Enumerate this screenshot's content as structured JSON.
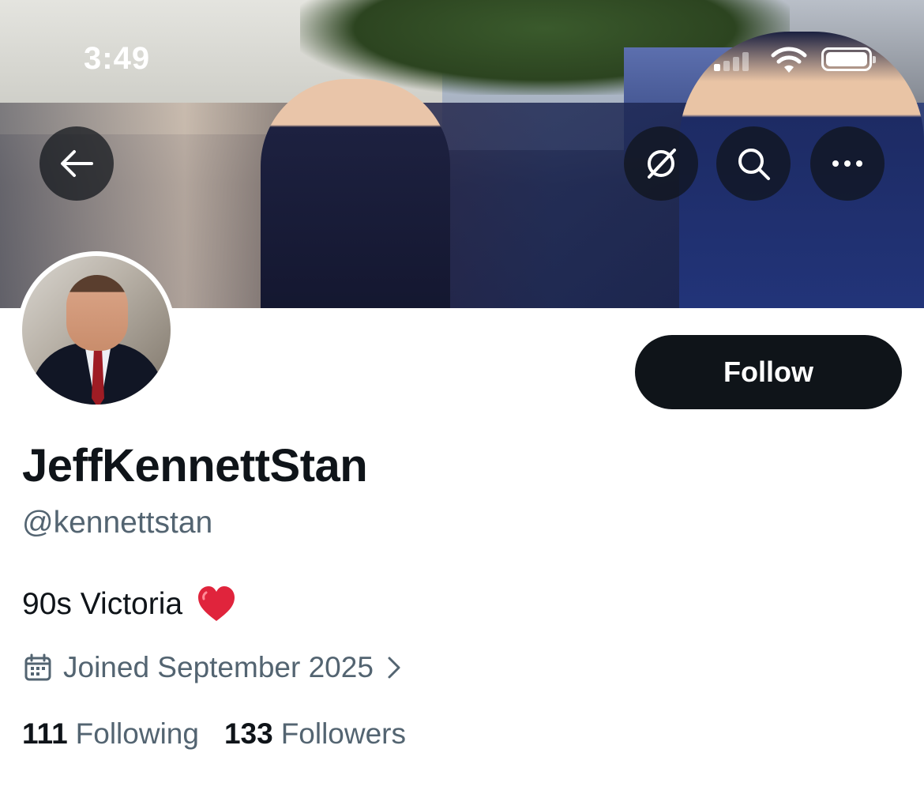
{
  "status_bar": {
    "time": "3:49"
  },
  "header": {
    "back_icon": "back-arrow-icon",
    "grok_icon": "grok-icon",
    "search_icon": "search-icon",
    "more_icon": "more-icon"
  },
  "profile": {
    "display_name": "JeffKennettStan",
    "handle": "@kennettstan",
    "bio_text": "90s Victoria",
    "bio_emoji": "heart-icon",
    "joined": "Joined September 2025",
    "following_count": "111",
    "following_label": "Following",
    "followers_count": "133",
    "followers_label": "Followers"
  },
  "actions": {
    "follow_label": "Follow"
  },
  "colors": {
    "primary_text": "#0f1419",
    "secondary_text": "#536471",
    "follow_bg": "#0f1419",
    "heart": "#e0243c"
  }
}
